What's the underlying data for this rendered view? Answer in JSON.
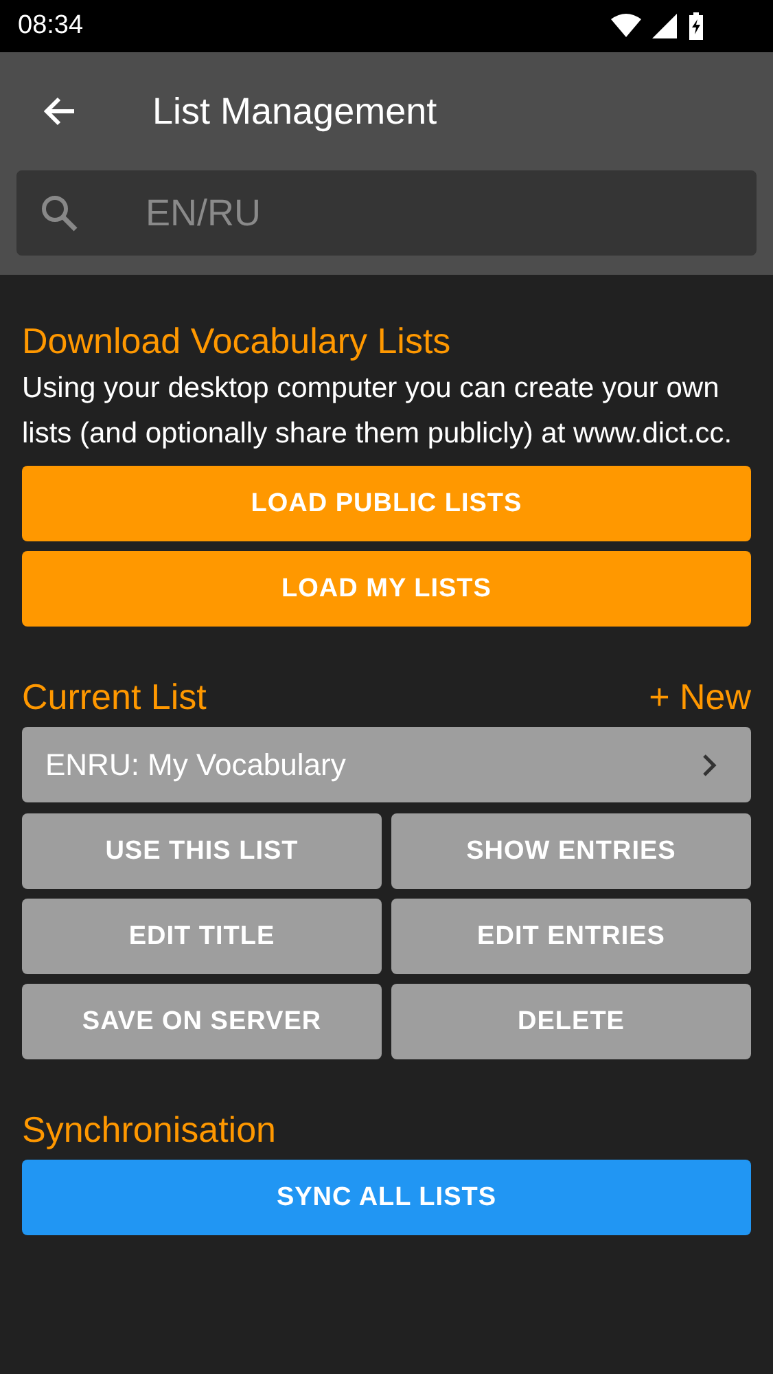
{
  "status_bar": {
    "time": "08:34"
  },
  "toolbar": {
    "title": "List Management"
  },
  "search": {
    "placeholder": "EN/RU"
  },
  "download": {
    "heading": "Download Vocabulary Lists",
    "text": "Using your desktop computer you can create your own lists (and optionally share them publicly) at www.dict.cc.",
    "buttons": [
      "LOAD PUBLIC LISTS",
      "LOAD MY LISTS"
    ]
  },
  "current_list": {
    "heading": "Current List",
    "new_link": "+ New",
    "selector": "ENRU: My Vocabulary",
    "buttons": [
      "USE THIS LIST",
      "SHOW ENTRIES",
      "EDIT TITLE",
      "EDIT ENTRIES",
      "SAVE ON SERVER",
      "DELETE"
    ]
  },
  "sync": {
    "heading": "Synchronisation",
    "button": "SYNC ALL LISTS"
  }
}
